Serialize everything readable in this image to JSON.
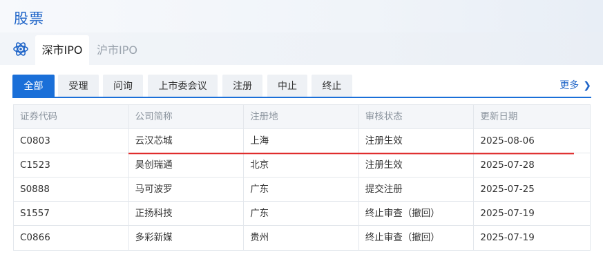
{
  "page": {
    "title": "股票"
  },
  "market_tabs": [
    {
      "label": "深市IPO",
      "active": true
    },
    {
      "label": "沪市IPO",
      "active": false
    }
  ],
  "market_icon": "atom-icon",
  "status_tabs": [
    {
      "label": "全部",
      "active": true
    },
    {
      "label": "受理",
      "active": false
    },
    {
      "label": "问询",
      "active": false
    },
    {
      "label": "上市委会议",
      "active": false
    },
    {
      "label": "注册",
      "active": false
    },
    {
      "label": "中止",
      "active": false
    },
    {
      "label": "终止",
      "active": false
    }
  ],
  "more": {
    "label": "更多",
    "icon": "chevron-right-icon"
  },
  "table": {
    "columns": [
      "证券代码",
      "公司简称",
      "注册地",
      "审核状态",
      "更新日期"
    ],
    "rows": [
      [
        "C0803",
        "云汉芯城",
        "上海",
        "注册生效",
        "2025-08-06"
      ],
      [
        "C1523",
        "昊创瑞通",
        "北京",
        "注册生效",
        "2025-07-28"
      ],
      [
        "S0888",
        "马可波罗",
        "广东",
        "提交注册",
        "2025-07-25"
      ],
      [
        "S1557",
        "正扬科技",
        "广东",
        "终止审查（撤回）",
        "2025-07-19"
      ],
      [
        "C0866",
        "多彩新媒",
        "贵州",
        "终止审查（撤回）",
        "2025-07-19"
      ]
    ]
  },
  "colors": {
    "accent": "#1a6fd8",
    "annotation": "#e02020"
  }
}
